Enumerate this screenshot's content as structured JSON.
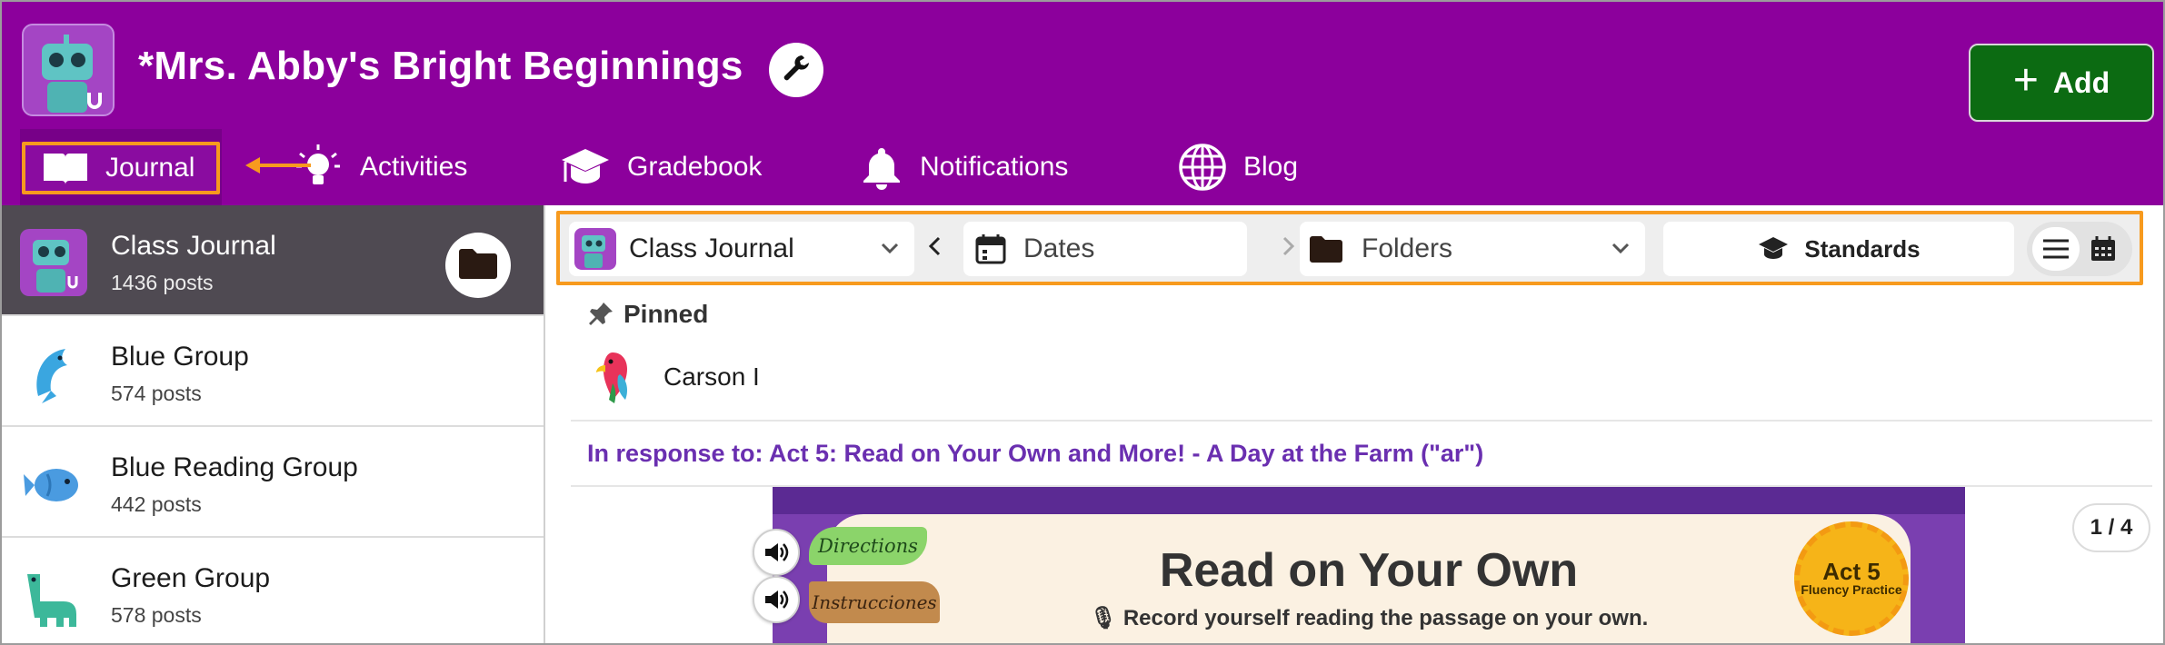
{
  "header": {
    "class_title": "*Mrs. Abby's Bright Beginnings",
    "add_label": "Add",
    "add_icon": "plus-icon",
    "settings_icon": "wrench-icon"
  },
  "nav": {
    "items": [
      {
        "label": "Journal",
        "icon": "book-icon",
        "active": true
      },
      {
        "label": "Activities",
        "icon": "lightbulb-icon"
      },
      {
        "label": "Gradebook",
        "icon": "graduation-cap-icon"
      },
      {
        "label": "Notifications",
        "icon": "bell-icon"
      },
      {
        "label": "Blog",
        "icon": "globe-icon"
      }
    ]
  },
  "sidebar": {
    "groups": [
      {
        "name": "Class Journal",
        "count": "1436 posts",
        "icon": "robot-avatar-icon",
        "active": true
      },
      {
        "name": "Blue Group",
        "count": "574 posts",
        "icon": "dolphin-icon"
      },
      {
        "name": "Blue Reading Group",
        "count": "442 posts",
        "icon": "fish-icon"
      },
      {
        "name": "Green Group",
        "count": "578 posts",
        "icon": "dinosaur-icon"
      }
    ],
    "folder_icon": "folder-icon"
  },
  "toolbar": {
    "class_select": "Class Journal",
    "dates_label": "Dates",
    "folders_label": "Folders",
    "standards_label": "Standards",
    "view_modes": [
      "list-view-icon",
      "calendar-view-icon"
    ]
  },
  "post": {
    "pinned_label": "Pinned",
    "author": "Carson I",
    "response": "In response to: Act 5: Read on Your Own and More! - A Day at the Farm (\"ar\")",
    "activity": {
      "title": "Read on Your Own",
      "subtitle": "Record yourself reading the passage on your own.",
      "directions": "Directions",
      "instructions": "Instrucciones",
      "badge_act": "Act 5",
      "badge_sub": "Fluency Practice"
    },
    "pager": "1 / 4"
  },
  "colors": {
    "header_purple": "#8c009c",
    "add_green": "#0c6b12",
    "highlight_orange": "#f79a1e",
    "link_purple": "#6a2fb0"
  }
}
